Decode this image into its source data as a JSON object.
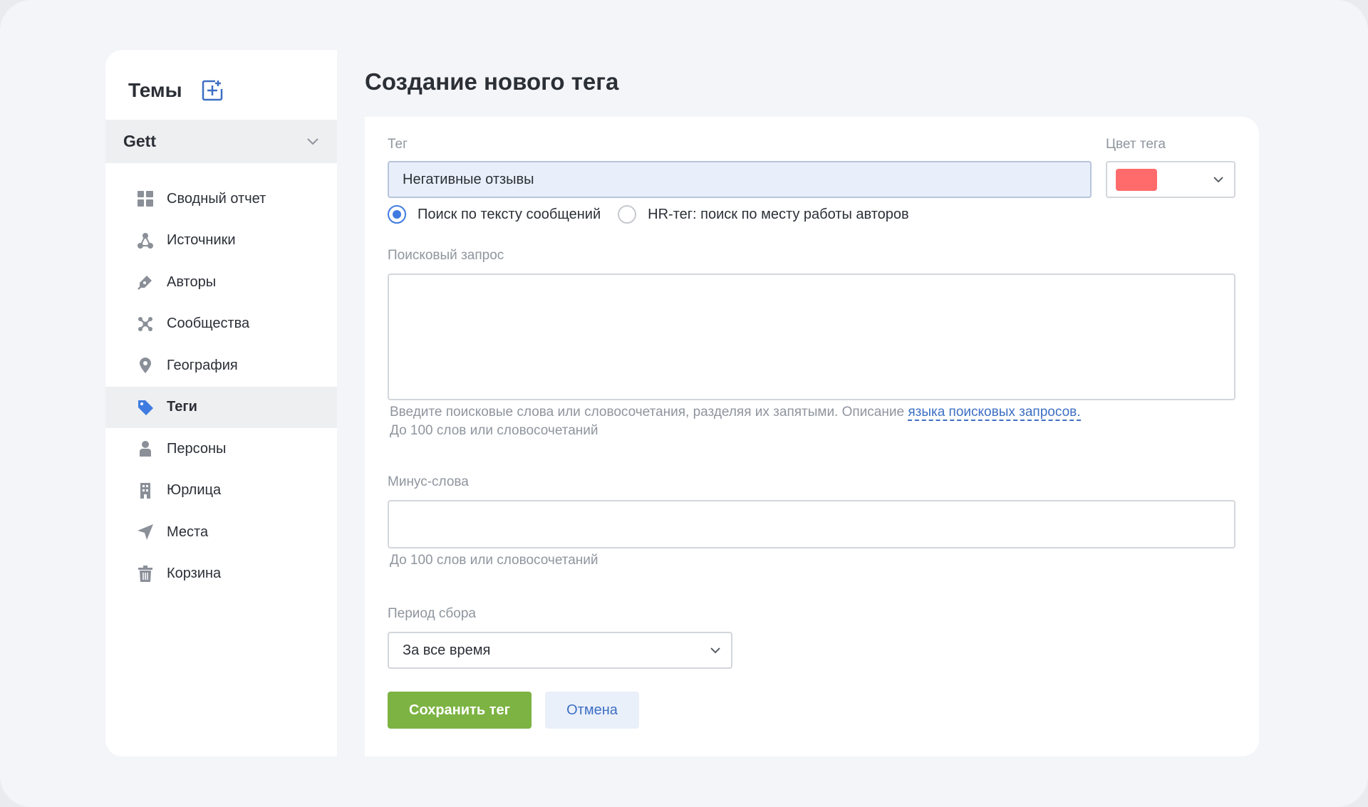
{
  "sidebar": {
    "title": "Темы",
    "add_icon": "add-square-icon",
    "project": "Gett",
    "items": [
      {
        "label": "Сводный отчет",
        "icon": "grid-icon",
        "active": false
      },
      {
        "label": "Источники",
        "icon": "network-icon",
        "active": false
      },
      {
        "label": "Авторы",
        "icon": "pen-icon",
        "active": false
      },
      {
        "label": "Сообщества",
        "icon": "community-icon",
        "active": false
      },
      {
        "label": "География",
        "icon": "map-pin-icon",
        "active": false
      },
      {
        "label": "Теги",
        "icon": "tag-icon",
        "active": true
      },
      {
        "label": "Персоны",
        "icon": "person-icon",
        "active": false
      },
      {
        "label": "Юрлица",
        "icon": "building-icon",
        "active": false
      },
      {
        "label": "Места",
        "icon": "navigation-icon",
        "active": false
      },
      {
        "label": "Корзина",
        "icon": "trash-icon",
        "active": false
      }
    ]
  },
  "main": {
    "title": "Создание нового тега",
    "tag_label": "Тег",
    "tag_value": "Негативные отзывы",
    "color_label": "Цвет тега",
    "color_value": "#ff6b6b",
    "radio_text": "Поиск по тексту сообщений",
    "radio_hr": "HR-тег: поиск по месту работы авторов",
    "query_label": "Поисковый запрос",
    "query_value": "",
    "query_hint": "Введите поисковые слова или словосочетания, разделяя их запятыми. Описание ",
    "query_hint_link": "языка поисковых запросов.",
    "query_limit": "До 100 слов или словосочетаний",
    "minus_label": "Минус-слова",
    "minus_value": "",
    "minus_limit": "До 100 слов или словосочетаний",
    "period_label": "Период сбора",
    "period_value": "За все время",
    "save_label": "Сохранить тег",
    "cancel_label": "Отмена"
  },
  "colors": {
    "accent": "#3f7be0",
    "save": "#7cb342",
    "link": "#3d6fc4"
  }
}
